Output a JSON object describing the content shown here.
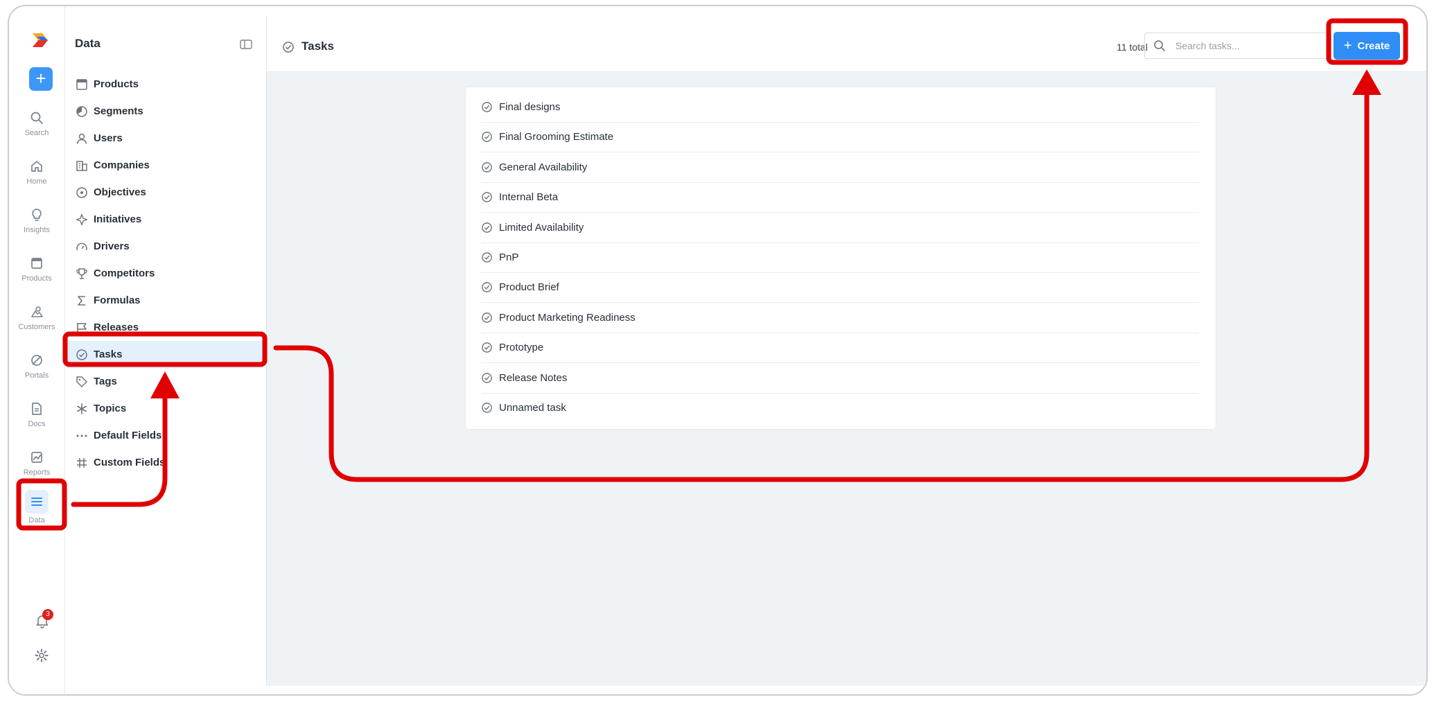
{
  "rail": {
    "items": [
      {
        "label": "Search",
        "icon": "search-icon"
      },
      {
        "label": "Home",
        "icon": "home-icon"
      },
      {
        "label": "Insights",
        "icon": "lightbulb-icon"
      },
      {
        "label": "Products",
        "icon": "window-icon"
      },
      {
        "label": "Customers",
        "icon": "customers-icon"
      },
      {
        "label": "Portals",
        "icon": "portal-icon"
      },
      {
        "label": "Docs",
        "icon": "document-icon"
      },
      {
        "label": "Reports",
        "icon": "chart-icon"
      },
      {
        "label": "Data",
        "icon": "list-icon"
      }
    ],
    "notification_count": "3",
    "create_symbol": "+"
  },
  "sidebar": {
    "title": "Data",
    "items": [
      {
        "label": "Products",
        "icon": "window-icon"
      },
      {
        "label": "Segments",
        "icon": "pie-icon"
      },
      {
        "label": "Users",
        "icon": "user-icon"
      },
      {
        "label": "Companies",
        "icon": "building-icon"
      },
      {
        "label": "Objectives",
        "icon": "target-icon"
      },
      {
        "label": "Initiatives",
        "icon": "sparkle-icon"
      },
      {
        "label": "Drivers",
        "icon": "gauge-icon"
      },
      {
        "label": "Competitors",
        "icon": "trophy-icon"
      },
      {
        "label": "Formulas",
        "icon": "sigma-icon"
      },
      {
        "label": "Releases",
        "icon": "flag-icon"
      },
      {
        "label": "Tasks",
        "icon": "check-circle-icon"
      },
      {
        "label": "Tags",
        "icon": "tag-icon"
      },
      {
        "label": "Topics",
        "icon": "asterisk-icon"
      },
      {
        "label": "Default Fields",
        "icon": "dots-icon"
      },
      {
        "label": "Custom Fields",
        "icon": "hash-icon"
      }
    ]
  },
  "header": {
    "title": "Tasks",
    "total": "11 total",
    "search_placeholder": "Search tasks...",
    "create_label": "Create"
  },
  "tasks": [
    "Final designs",
    "Final Grooming Estimate",
    "General Availability",
    "Internal Beta",
    "Limited Availability",
    "PnP",
    "Product Brief",
    "Product Marketing Readiness",
    "Prototype",
    "Release Notes",
    "Unnamed task"
  ],
  "help_label": "?",
  "colors": {
    "accent": "#2e8ef5",
    "annotation": "#e00000",
    "selected_bg": "#e5f0fd"
  }
}
